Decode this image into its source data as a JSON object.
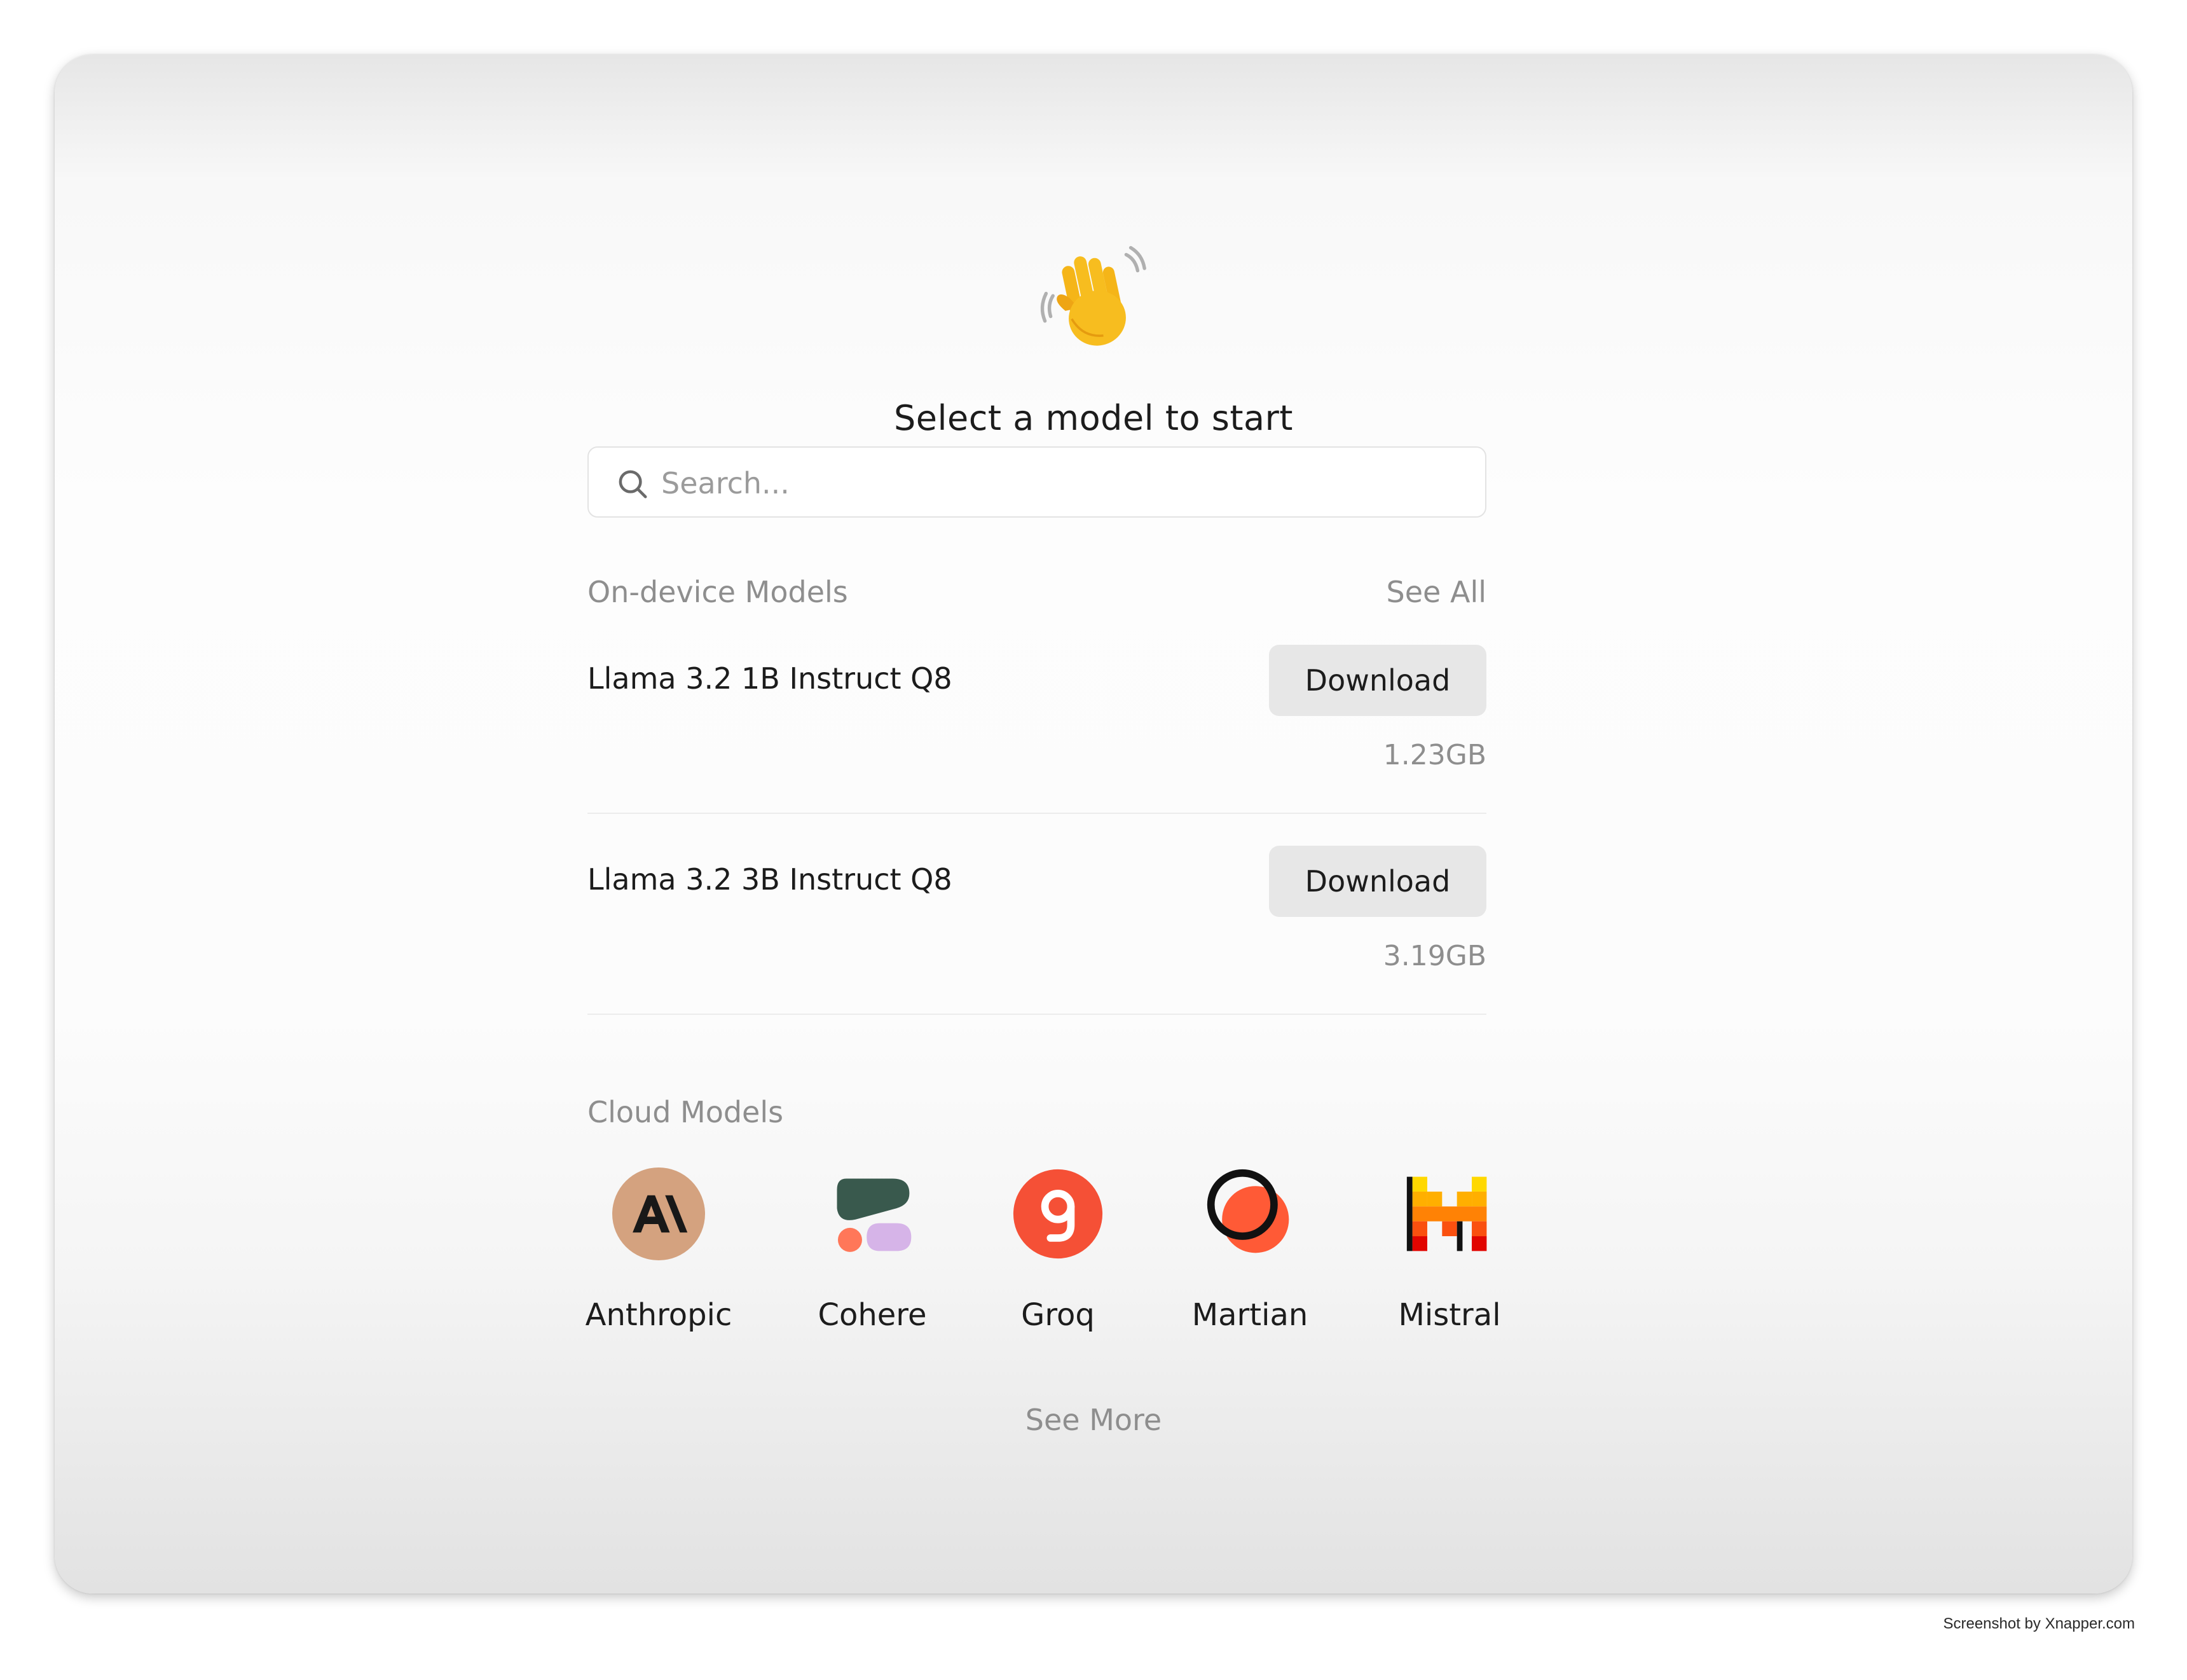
{
  "header": {
    "emoji": "👋",
    "title": "Select a model to start"
  },
  "search": {
    "placeholder": "Search..."
  },
  "on_device": {
    "label": "On-device Models",
    "see_all": "See All",
    "models": [
      {
        "name": "Llama 3.2 1B Instruct Q8",
        "button": "Download",
        "size": "1.23GB"
      },
      {
        "name": "Llama 3.2 3B Instruct Q8",
        "button": "Download",
        "size": "3.19GB"
      }
    ]
  },
  "cloud": {
    "label": "Cloud Models",
    "providers": [
      {
        "name": "Anthropic",
        "icon": "anthropic-logo-icon"
      },
      {
        "name": "Cohere",
        "icon": "cohere-logo-icon"
      },
      {
        "name": "Groq",
        "icon": "groq-logo-icon"
      },
      {
        "name": "Martian",
        "icon": "martian-logo-icon"
      },
      {
        "name": "Mistral",
        "icon": "mistral-logo-icon"
      }
    ],
    "see_more": "See More"
  },
  "colors": {
    "anthropic": "#d4a27f",
    "cohere_dark": "#39594d",
    "cohere_orange": "#ff7759",
    "cohere_lilac": "#d6b4e8",
    "groq": "#f55036",
    "martian": "#ff5a36",
    "mistral_yellow": "#ffd800",
    "mistral_orange": "#ff8205",
    "mistral_red": "#e10500"
  },
  "watermark": "Screenshot by Xnapper.com"
}
